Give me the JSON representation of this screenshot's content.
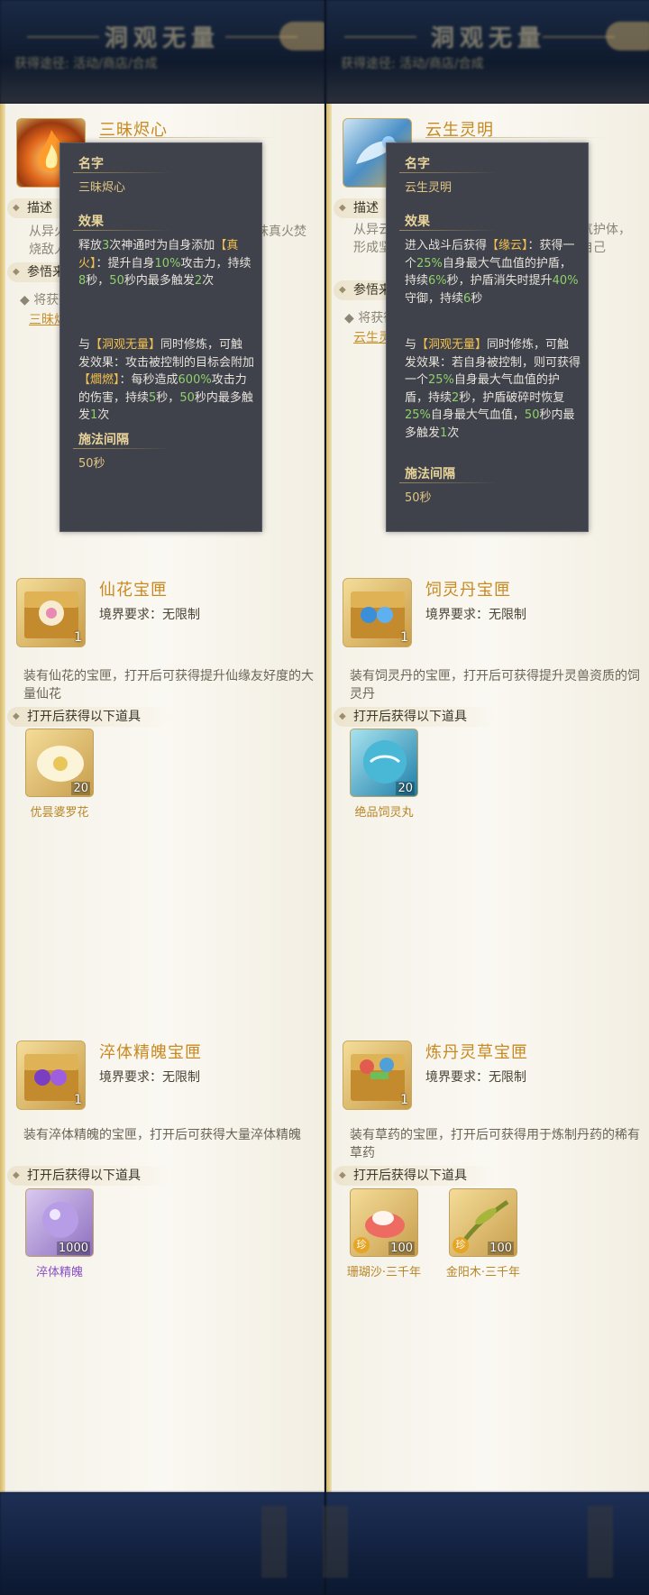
{
  "left": {
    "header_title": "洞观无量",
    "header_sub": "获得途径: 活动/商店/合成",
    "card1": {
      "name": "三昧烬心",
      "desc_behind": "从异火中提炼而出的真火之种，可召唤三昧真火焚烧敌人，造成持续灼烧并附加自身伤害",
      "section_desc": "描述",
      "section_ref": "参悟来源",
      "ref_text": "将获得",
      "ref_link": "三昧烬心",
      "tooltip": {
        "name_label": "名字",
        "name_value": "三昧烬心",
        "effect_label": "效果",
        "effect_p1_a": "释放",
        "effect_p1_b": "3",
        "effect_p1_c": "次神通时为自身添加",
        "effect_p1_d": "【真火】",
        "effect_p1_e": "：提升自身",
        "effect_p1_f": "10%",
        "effect_p1_g": "攻击力，持续",
        "effect_p1_h": "8",
        "effect_p1_i": "秒，",
        "effect_p1_j": "50",
        "effect_p1_k": "秒内最多触发",
        "effect_p1_l": "2",
        "effect_p1_m": "次",
        "effect_p2_a": "与",
        "effect_p2_b": "【洞观无量】",
        "effect_p2_c": "同时修炼，可触发效果：攻击被控制的目标会附加",
        "effect_p2_d": "【爓燃】",
        "effect_p2_e": "：每秒造成",
        "effect_p2_f": "600%",
        "effect_p2_g": "攻击力的伤害，持续",
        "effect_p2_h": "5",
        "effect_p2_i": "秒，",
        "effect_p2_j": "50",
        "effect_p2_k": "秒内最多触发",
        "effect_p2_l": "1",
        "effect_p2_m": "次",
        "cast_label": "施法间隔",
        "cast_value": "50秒"
      }
    },
    "card2": {
      "name": "仙花宝匣",
      "req": "境界要求：无限制",
      "qty": "1",
      "desc": "装有仙花的宝匣，打开后可获得提升仙缘友好度的大量仙花",
      "section": "打开后获得以下道具",
      "items": [
        {
          "name": "优昙婆罗花",
          "qty": "20"
        }
      ]
    },
    "card3": {
      "name": "淬体精魄宝匣",
      "req": "境界要求：无限制",
      "qty": "1",
      "desc": "装有淬体精魄的宝匣，打开后可获得大量淬体精魄",
      "section": "打开后获得以下道具",
      "items": [
        {
          "name": "淬体精魄",
          "qty": "1000"
        }
      ]
    }
  },
  "right": {
    "header_title": "洞观无量",
    "header_sub": "获得途径: 活动/商店/合成",
    "card1": {
      "name": "云生灵明",
      "desc_behind": "从异云中凝聚而出的灵明之气，以周遭灵气护体，形成坚固的护盾，讲求以守代攻，以保护自己",
      "section_desc": "描述",
      "section_ref": "参悟来源",
      "ref_text": "将获得",
      "ref_link": "云生灵明",
      "tooltip": {
        "name_label": "名字",
        "name_value": "云生灵明",
        "effect_label": "效果",
        "effect_p1_a": "进入战斗后获得",
        "effect_p1_b": "【缘云】",
        "effect_p1_c": "：获得一个",
        "effect_p1_d": "25%",
        "effect_p1_e": "自身最大气血值的护盾，持续",
        "effect_p1_f": "6%",
        "effect_p1_g": "秒，护盾消失时提升",
        "effect_p1_h": "40%",
        "effect_p1_i": "守御，持续",
        "effect_p1_j": "6",
        "effect_p1_k": "秒",
        "effect_p2_a": "与",
        "effect_p2_b": "【洞观无量】",
        "effect_p2_c": "同时修炼，可触发效果：若自身被控制，则可获得一个",
        "effect_p2_d": "25%",
        "effect_p2_e": "自身最大气血值的护盾，持续",
        "effect_p2_f": "2",
        "effect_p2_g": "秒，护盾破碎时恢复",
        "effect_p2_h": "25%",
        "effect_p2_i": "自身最大气血值，",
        "effect_p2_j": "50",
        "effect_p2_k": "秒内最多触发",
        "effect_p2_l": "1",
        "effect_p2_m": "次",
        "cast_label": "施法间隔",
        "cast_value": "50秒"
      }
    },
    "card2": {
      "name": "饲灵丹宝匣",
      "req": "境界要求：无限制",
      "qty": "1",
      "desc": "装有饲灵丹的宝匣，打开后可获得提升灵兽资质的饲灵丹",
      "section": "打开后获得以下道具",
      "items": [
        {
          "name": "绝品饲灵丸",
          "qty": "20"
        }
      ]
    },
    "card3": {
      "name": "炼丹灵草宝匣",
      "req": "境界要求：无限制",
      "qty": "1",
      "desc": "装有草药的宝匣，打开后可获得用于炼制丹药的稀有草药",
      "section": "打开后获得以下道具",
      "items": [
        {
          "name": "珊瑚沙·三千年",
          "qty": "100",
          "tag": "珍"
        },
        {
          "name": "金阳木·三千年",
          "qty": "100",
          "tag": "珍"
        }
      ]
    }
  },
  "colors": {
    "gold_text": "#c88a20",
    "green_value": "#8fd16a",
    "yellow_tag": "#f1c04e",
    "tooltip_bg": "#3f414b",
    "parchment": "#f7f4eb"
  }
}
